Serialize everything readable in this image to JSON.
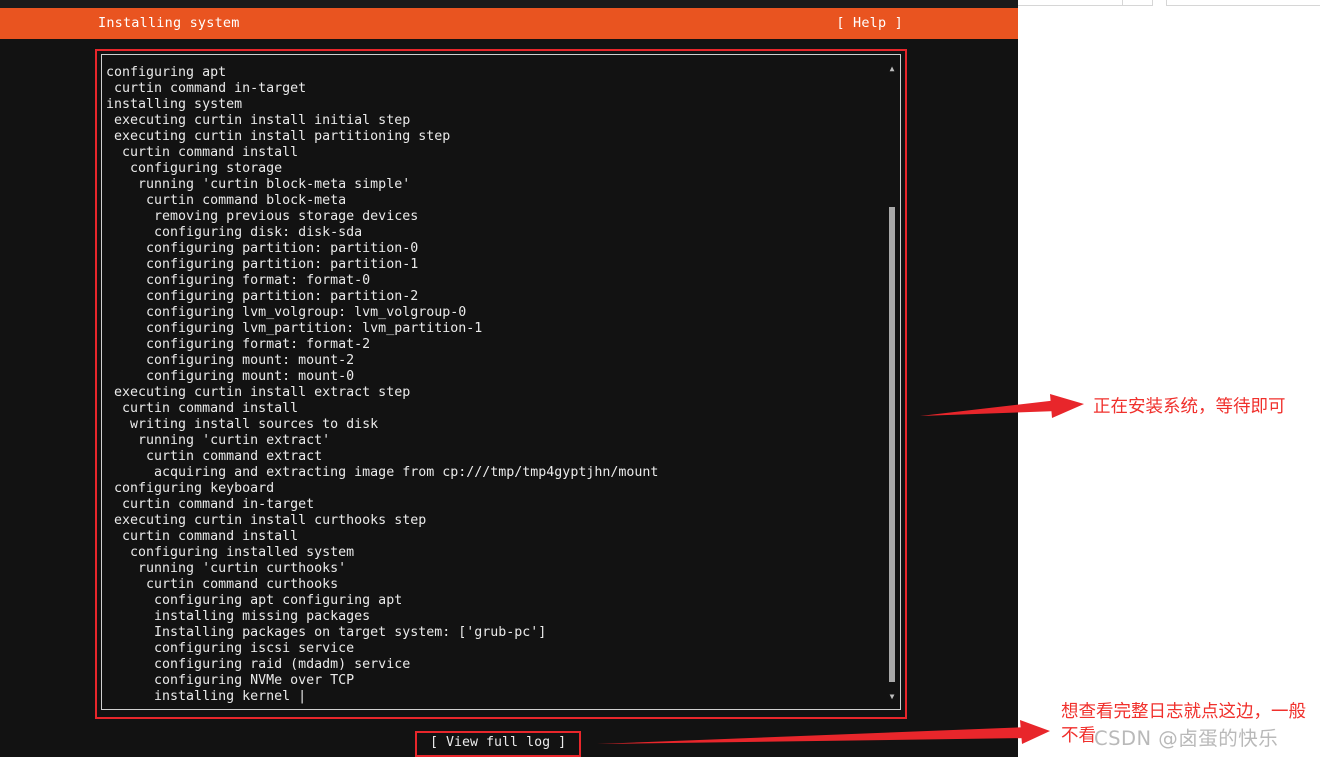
{
  "header": {
    "title": "Installing system",
    "help_label": "[ Help ]"
  },
  "log": {
    "lines": [
      "configuring apt",
      " curtin command in-target",
      "installing system",
      " executing curtin install initial step",
      " executing curtin install partitioning step",
      "  curtin command install",
      "   configuring storage",
      "    running 'curtin block-meta simple'",
      "     curtin command block-meta",
      "      removing previous storage devices",
      "      configuring disk: disk-sda",
      "     configuring partition: partition-0",
      "     configuring partition: partition-1",
      "     configuring format: format-0",
      "     configuring partition: partition-2",
      "     configuring lvm_volgroup: lvm_volgroup-0",
      "     configuring lvm_partition: lvm_partition-1",
      "     configuring format: format-2",
      "     configuring mount: mount-2",
      "     configuring mount: mount-0",
      " executing curtin install extract step",
      "  curtin command install",
      "   writing install sources to disk",
      "    running 'curtin extract'",
      "     curtin command extract",
      "      acquiring and extracting image from cp:///tmp/tmp4gyptjhn/mount",
      " configuring keyboard",
      "  curtin command in-target",
      " executing curtin install curthooks step",
      "  curtin command install",
      "   configuring installed system",
      "    running 'curtin curthooks'",
      "     curtin command curthooks",
      "      configuring apt configuring apt",
      "      installing missing packages",
      "      Installing packages on target system: ['grub-pc']",
      "      configuring iscsi service",
      "      configuring raid (mdadm) service",
      "      configuring NVMe over TCP",
      "      installing kernel |"
    ]
  },
  "footer": {
    "view_full_log_label": "[ View full log ]"
  },
  "annotations": {
    "log_note": "正在安装系统，等待即可",
    "view_log_note": "想查看完整日志就点这边，一般不看",
    "watermark": "CSDN @卤蛋的快乐"
  },
  "colors": {
    "header_bg": "#e95420",
    "terminal_bg": "#121212",
    "annotation_red": "#e8262b"
  }
}
